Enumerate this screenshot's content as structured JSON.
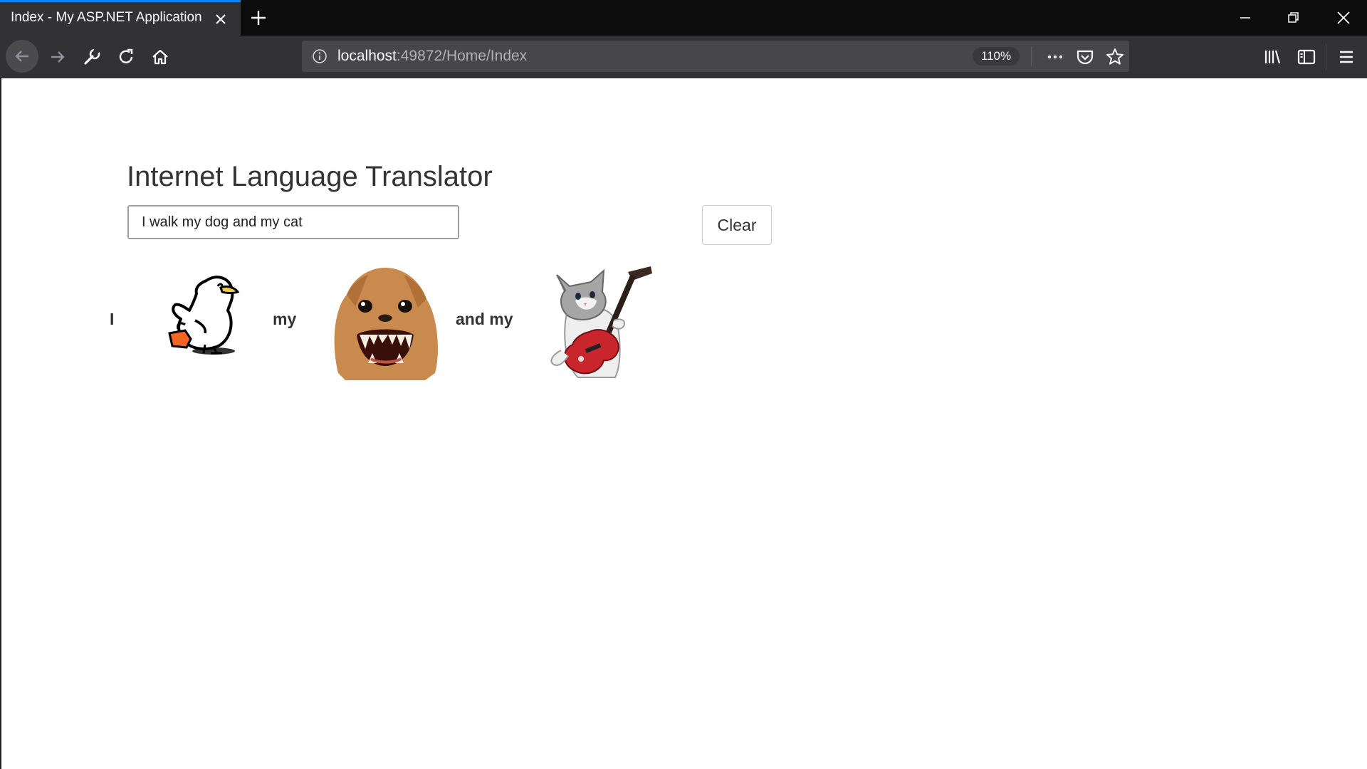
{
  "browser": {
    "tab_title": "Index - My ASP.NET Application",
    "url_host": "localhost",
    "url_path": ":49872/Home/Index",
    "zoom": "110%"
  },
  "page": {
    "title": "Internet Language Translator",
    "input_value": "I walk my dog and my cat",
    "clear_label": "Clear",
    "translation_words": [
      "I",
      "my",
      "and my"
    ],
    "translation_images": [
      "duck",
      "dog",
      "cat-playing-guitar"
    ]
  },
  "colors": {
    "tab_accent": "#0a84ff",
    "chrome_dark": "#0c0c0d",
    "toolbar": "#323234"
  }
}
